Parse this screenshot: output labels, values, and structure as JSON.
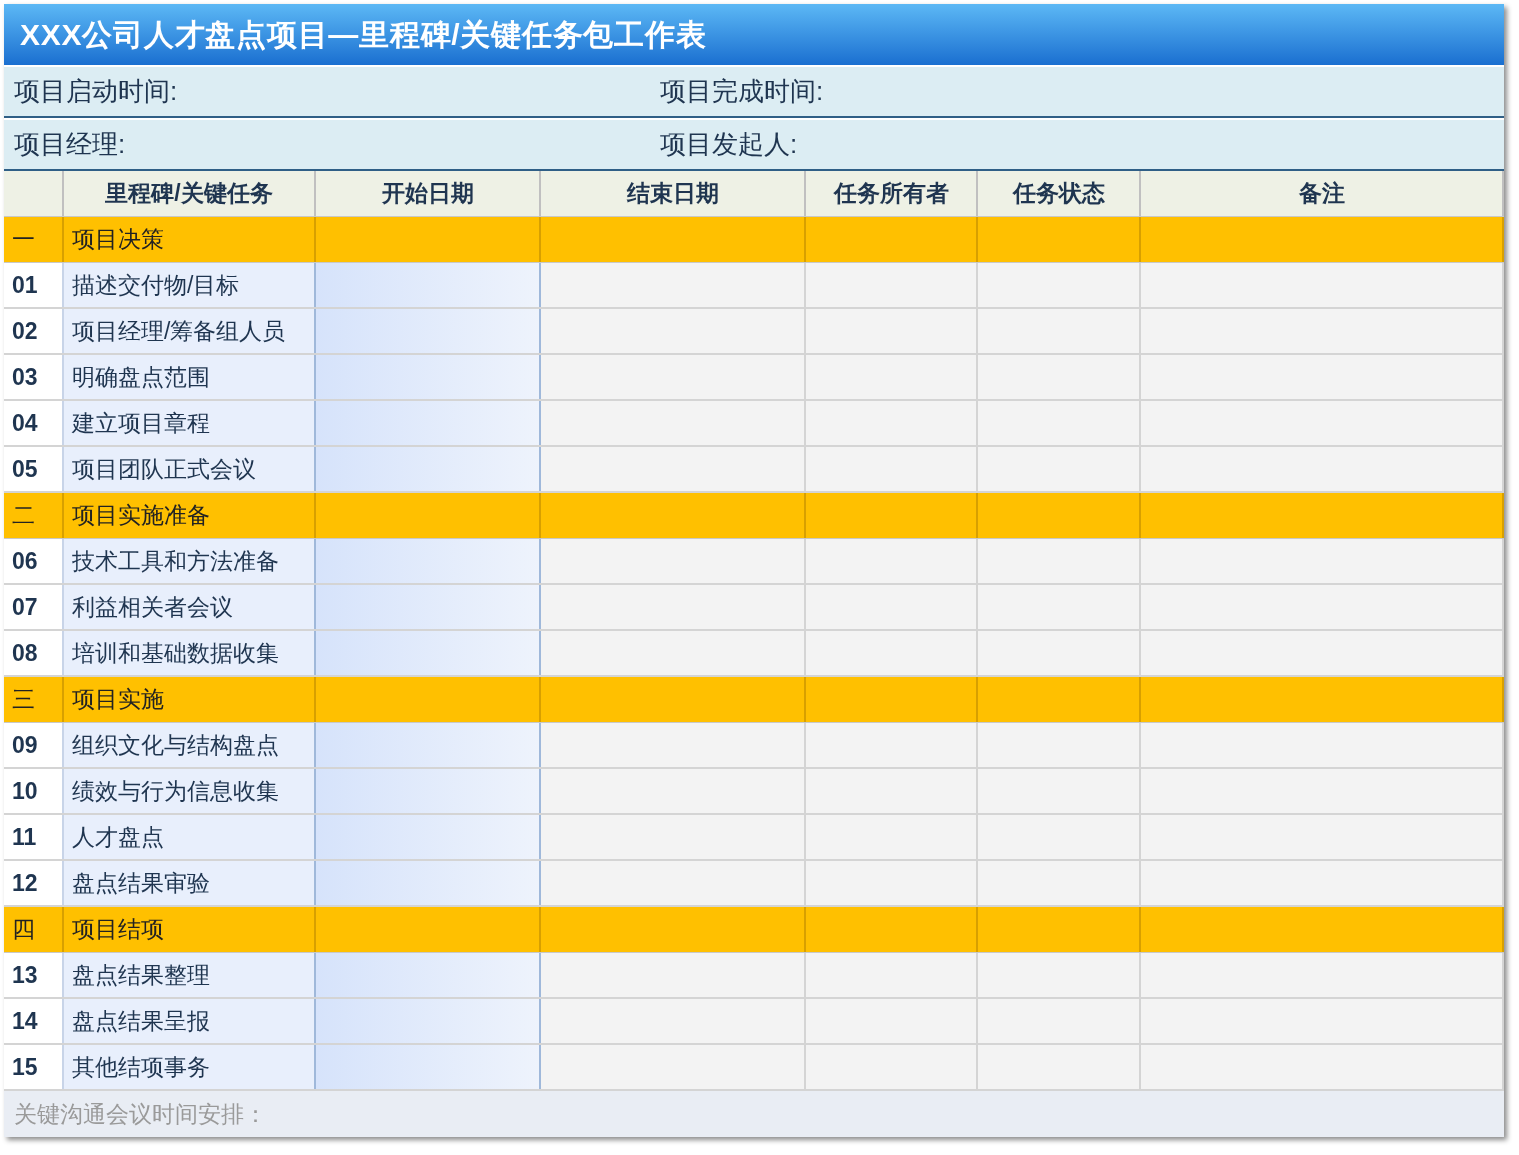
{
  "title": "XXX公司人才盘点项目—里程碑/关键任务包工作表",
  "info_rows": [
    {
      "fields": [
        "项目启动时间:",
        "项目完成时间:"
      ]
    },
    {
      "fields": [
        "项目经理:",
        "项目发起人:"
      ]
    }
  ],
  "columns": [
    "里程碑/关键任务",
    "开始日期",
    "结束日期",
    "任务所有者",
    "任务状态",
    "备注"
  ],
  "sections": [
    {
      "number": "一",
      "name": "项目决策",
      "tasks": [
        {
          "number": "01",
          "name": "描述交付物/目标"
        },
        {
          "number": "02",
          "name": "项目经理/筹备组人员"
        },
        {
          "number": "03",
          "name": "明确盘点范围"
        },
        {
          "number": "04",
          "name": "建立项目章程"
        },
        {
          "number": "05",
          "name": "项目团队正式会议"
        }
      ]
    },
    {
      "number": "二",
      "name": "项目实施准备",
      "tasks": [
        {
          "number": "06",
          "name": "技术工具和方法准备"
        },
        {
          "number": "07",
          "name": "利益相关者会议"
        },
        {
          "number": "08",
          "name": "培训和基础数据收集"
        }
      ]
    },
    {
      "number": "三",
      "name": "项目实施",
      "tasks": [
        {
          "number": "09",
          "name": "组织文化与结构盘点"
        },
        {
          "number": "10",
          "name": "绩效与行为信息收集"
        },
        {
          "number": "11",
          "name": "人才盘点"
        },
        {
          "number": "12",
          "name": "盘点结果审验"
        }
      ]
    },
    {
      "number": "四",
      "name": "项目结项",
      "tasks": [
        {
          "number": "13",
          "name": "盘点结果整理"
        },
        {
          "number": "14",
          "name": "盘点结果呈报"
        },
        {
          "number": "15",
          "name": "其他结项事务"
        }
      ]
    }
  ],
  "footer": "关键沟通会议时间安排："
}
